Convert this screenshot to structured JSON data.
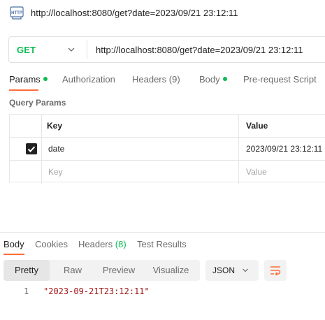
{
  "window": {
    "title": "http://localhost:8080/get?date=2023/09/21 23:12:11"
  },
  "icons": {
    "http": "http-request-icon",
    "chevron": "chevron-down-icon",
    "wrap": "word-wrap-icon",
    "check": "checkmark-icon"
  },
  "request": {
    "method": "GET",
    "url": "http://localhost:8080/get?date=2023/09/21 23:12:11"
  },
  "request_tabs": [
    {
      "label": "Params",
      "dot": true,
      "active": true
    },
    {
      "label": "Authorization"
    },
    {
      "label": "Headers",
      "count": "(9)"
    },
    {
      "label": "Body",
      "dot": true
    },
    {
      "label": "Pre-request Script"
    }
  ],
  "query_params": {
    "title": "Query Params",
    "headers": {
      "key": "Key",
      "value": "Value"
    },
    "rows": [
      {
        "checked": true,
        "key": "date",
        "value": "2023/09/21 23:12:11"
      }
    ],
    "placeholder": {
      "key": "Key",
      "value": "Value"
    }
  },
  "response_tabs": [
    {
      "label": "Body",
      "active": true
    },
    {
      "label": "Cookies"
    },
    {
      "label": "Headers",
      "count": "(8)"
    },
    {
      "label": "Test Results"
    }
  ],
  "view_modes": [
    {
      "label": "Pretty",
      "active": true
    },
    {
      "label": "Raw"
    },
    {
      "label": "Preview"
    },
    {
      "label": "Visualize"
    }
  ],
  "format": {
    "selected": "JSON"
  },
  "response_body": [
    {
      "line": "1",
      "text": "\"2023-09-21T23:12:11\""
    }
  ],
  "colors": {
    "accent": "#ff6c37",
    "method": "#0cbb52",
    "string": "#a31515"
  }
}
